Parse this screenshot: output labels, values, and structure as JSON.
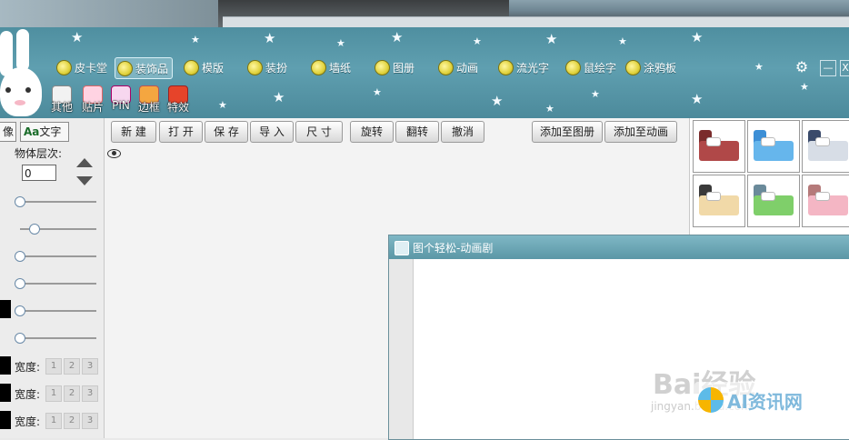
{
  "toolbar": {
    "categories": [
      "皮卡堂",
      "装饰品",
      "模版",
      "装扮",
      "墙纸",
      "图册",
      "动画",
      "流光字",
      "鼠绘字",
      "涂鸦板"
    ],
    "selected_category": "装饰品",
    "sub_items": [
      "其他",
      "贴片",
      "PIN",
      "边框",
      "特效"
    ],
    "window_buttons": {
      "settings": "⚙",
      "minimize": "—",
      "close": "X"
    }
  },
  "left_panel": {
    "tabs": [
      "像",
      "文字"
    ],
    "layer_label": "物体层次:",
    "layer_value": "0",
    "width_label": "宽度:",
    "width_options": [
      "1",
      "2",
      "3"
    ]
  },
  "canvas_toolbar": {
    "new": "新 建",
    "open": "打 开",
    "save": "保 存",
    "import": "导 入",
    "size": "尺 寸",
    "rotate": "旋转",
    "flip": "翻转",
    "undo": "撤消",
    "add_album": "添加至图册",
    "add_anim": "添加至动画"
  },
  "popup": {
    "title": "图个轻松-动画剧"
  },
  "watermark": {
    "baidu": "Bai经验",
    "jingyan": "jingyan.baidu.com",
    "ai": "AI资讯网"
  }
}
